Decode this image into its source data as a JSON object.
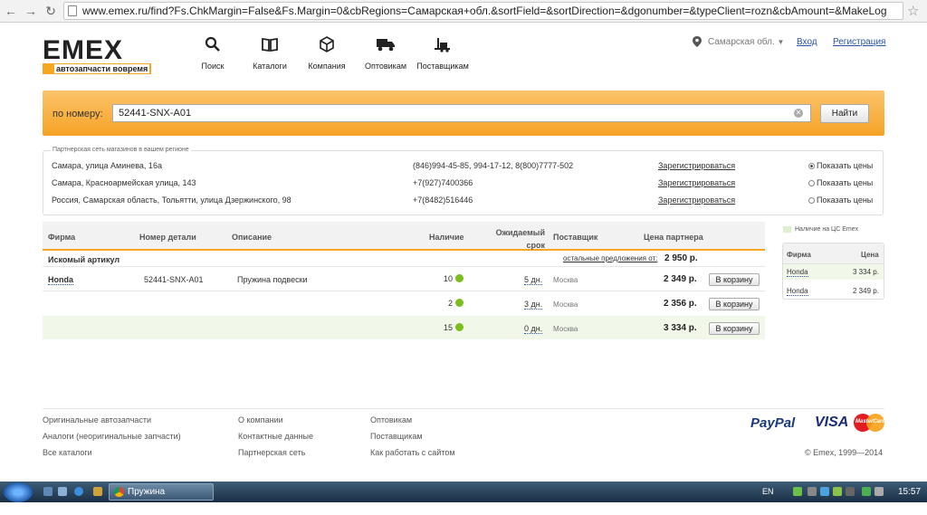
{
  "browser": {
    "url": "www.emex.ru/find?Fs.ChkMargin=False&Fs.Margin=0&cbRegions=Самарская+обл.&sortField=&sortDirection=&dgonumber=&typeClient=rozn&cbAmount=&MakeLog"
  },
  "header": {
    "logo_text": "EMEX",
    "tagline": "автозапчасти вовремя",
    "nav": [
      {
        "label": "Поиск"
      },
      {
        "label": "Каталоги"
      },
      {
        "label": "Компания"
      },
      {
        "label": "Оптовикам"
      },
      {
        "label": "Поставщикам"
      }
    ],
    "region": "Самарская обл.",
    "login": "Вход",
    "register": "Регистрация"
  },
  "search": {
    "label": "по номеру:",
    "value": "52441-SNX-A01",
    "button": "Найти"
  },
  "partners": {
    "title": "Партнерская сеть магазинов в вашем регионе",
    "rows": [
      {
        "address": "Самара, улица Аминева, 16а",
        "phone": "(846)994-45-85, 994-17-12, 8(800)7777-502",
        "register": "Зарегистрироваться",
        "show": "Показать цены"
      },
      {
        "address": "Самара, Красноармейская улица, 143",
        "phone": "+7(927)7400366",
        "register": "Зарегистрироваться",
        "show": "Показать цены"
      },
      {
        "address": "Россия, Самарская область, Тольятти, улица Дзержинского, 98",
        "phone": "+7(8482)516446",
        "register": "Зарегистрироваться",
        "show": "Показать цены"
      }
    ]
  },
  "results": {
    "headers": {
      "brand": "Фирма",
      "number": "Номер детали",
      "desc": "Описание",
      "stock": "Наличие",
      "eta": "Ожидаемый срок",
      "supplier": "Поставщик",
      "price": "Цена партнера"
    },
    "section": "Искомый артикул",
    "other_offers": "остальные предложения от:",
    "other_price": "2 950 р.",
    "rows": [
      {
        "brand": "Honda",
        "number": "52441-SNX-A01",
        "desc": "Пружина подвески",
        "stock": "10",
        "eta": "5 дн.",
        "supplier": "Москва",
        "price": "2 349 р.",
        "cart": "В корзину"
      },
      {
        "brand": "",
        "number": "",
        "desc": "",
        "stock": "2",
        "eta": "3 дн.",
        "supplier": "Москва",
        "price": "2 356 р.",
        "cart": "В корзину"
      },
      {
        "brand": "",
        "number": "",
        "desc": "",
        "stock": "15",
        "eta": "0 дн.",
        "supplier": "Москва",
        "price": "3 334 р.",
        "cart": "В корзину"
      }
    ]
  },
  "side": {
    "legend": "Наличие на ЦС Emex",
    "head_brand": "Фирма",
    "head_price": "Цена",
    "rows": [
      {
        "brand": "Honda",
        "price": "3 334 р."
      },
      {
        "brand": "Honda",
        "price": "2 349 р."
      }
    ]
  },
  "footer": {
    "col1": [
      "Оригинальные автозапчасти",
      "Аналоги (неоригинальные запчасти)",
      "Все каталоги"
    ],
    "col2": [
      "О компании",
      "Контактные данные",
      "Партнерская сеть"
    ],
    "col3": [
      "Оптовикам",
      "Поставщикам",
      "Как работать с сайтом"
    ],
    "paypal": "PayPal",
    "visa": "VISA",
    "mastercard": "MasterCard",
    "copyright": "© Emex, 1999—2014"
  },
  "taskbar": {
    "task": "Пружина подвески...",
    "lang": "EN",
    "time": "15:57"
  },
  "colors": {
    "accent": "#f5a623",
    "link": "#2a55a8",
    "stock_green": "#7bbf1f"
  }
}
